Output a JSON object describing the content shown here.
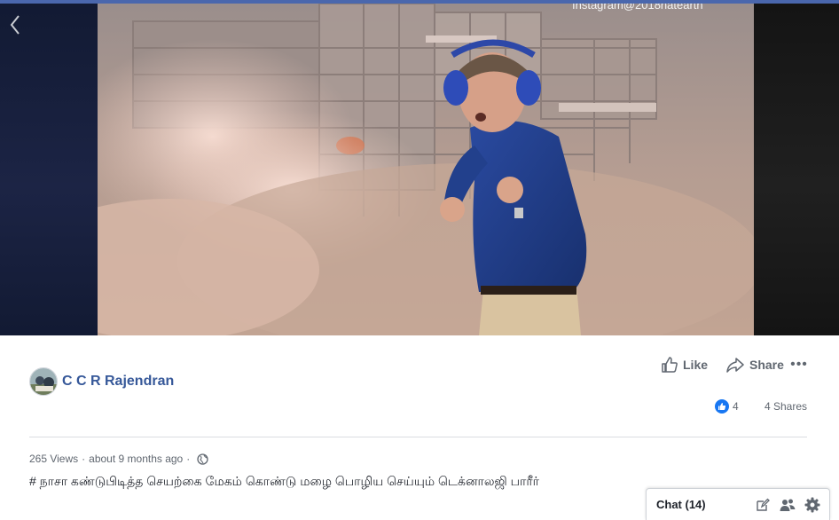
{
  "video": {
    "watermark": "Instagram@2018hateartn"
  },
  "post": {
    "author_name": "C C R Rajendran",
    "like_label": "Like",
    "share_label": "Share",
    "more_label": "•••",
    "reactions_count": "4",
    "shares_label": "4 Shares",
    "views": "265 Views",
    "separator": "·",
    "time_ago": "about 9 months ago",
    "caption": "# நாசா கண்டுபிடித்த செயற்கை மேகம் கொண்டு மழை பொழிய செய்யும் டெக்னாலஜி பாரீர்"
  },
  "chat": {
    "label": "Chat (14)"
  },
  "icons": {
    "back": "chevron-left-icon",
    "like": "thumbs-up-icon",
    "share": "share-arrow-icon",
    "reaction": "like-reaction-icon",
    "privacy": "globe-icon",
    "compose": "compose-icon",
    "group": "group-icon",
    "settings": "gear-icon"
  },
  "colors": {
    "brand_blue": "#4a67ad",
    "author_link": "#365899",
    "reaction_blue": "#1877f2",
    "muted_text": "#606770"
  }
}
